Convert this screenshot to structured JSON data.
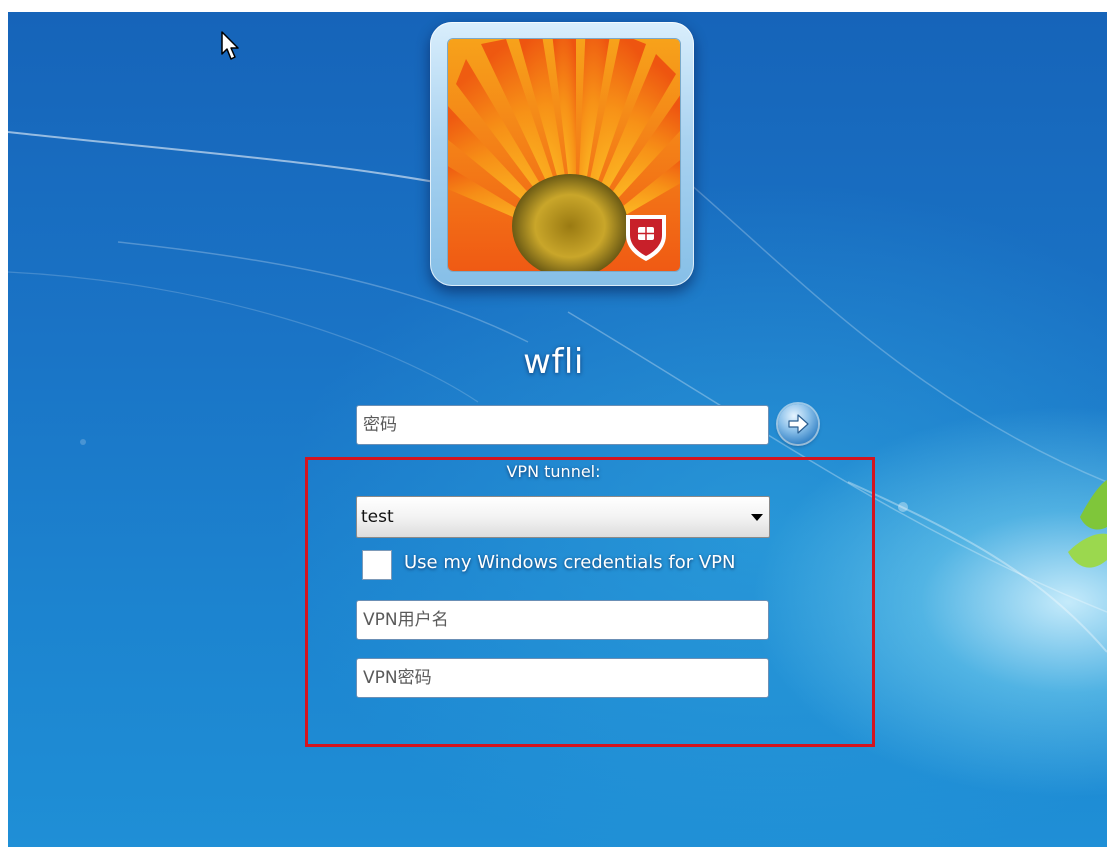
{
  "user": {
    "name": "wfli"
  },
  "login": {
    "password_placeholder": "密码",
    "submit_icon": "arrow-right-circle-icon"
  },
  "vpn": {
    "label": "VPN tunnel:",
    "selected_tunnel": "test",
    "use_windows_credentials_label": "Use my Windows credentials for VPN",
    "use_windows_credentials_checked": false,
    "username_placeholder": "VPN用户名",
    "password_placeholder": "VPN密码"
  },
  "colors": {
    "highlight_border": "#d4141f",
    "desktop_background": "#1a74c6"
  },
  "icons": {
    "avatar_badge": "shield-icon",
    "cursor": "mouse-pointer-icon"
  }
}
